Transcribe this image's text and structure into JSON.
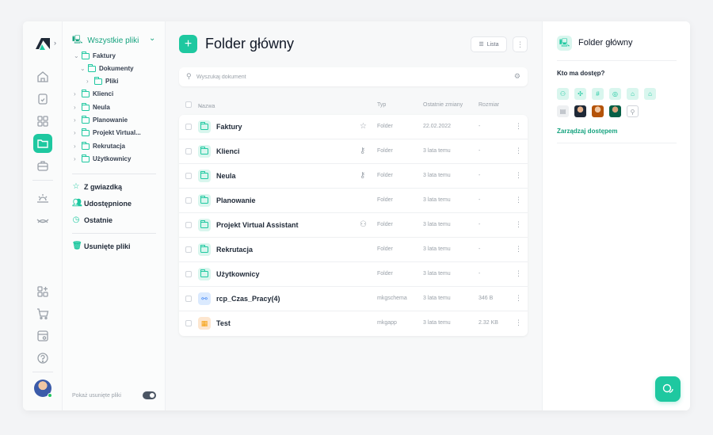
{
  "colors": {
    "accent": "#1ec8a0",
    "accent_dark": "#16a37f"
  },
  "tree": {
    "root_label": "Wszystkie pliki",
    "nodes": [
      {
        "label": "Faktury"
      },
      {
        "label": "Dokumenty"
      },
      {
        "label": "Pliki"
      },
      {
        "label": "Klienci"
      },
      {
        "label": "Neula"
      },
      {
        "label": "Planowanie"
      },
      {
        "label": "Projekt Virtual..."
      },
      {
        "label": "Rekrutacja"
      },
      {
        "label": "Użytkownicy"
      }
    ],
    "quick": [
      {
        "label": "Z gwiazdką",
        "icon": "star-icon"
      },
      {
        "label": "Udostępnione",
        "icon": "users-icon"
      },
      {
        "label": "Ostatnie",
        "icon": "clock-icon"
      },
      {
        "label": "Usunięte pliki",
        "icon": "trash-icon"
      }
    ],
    "show_deleted_label": "Pokaż usunięte pliki",
    "show_deleted_on": true
  },
  "main": {
    "title": "Folder główny",
    "view_label": "Lista",
    "search_placeholder": "Wyszukaj dokument",
    "columns": {
      "name": "Nazwa",
      "type": "Typ",
      "modified": "Ostatnie zmiany",
      "size": "Rozmiar"
    },
    "rows": [
      {
        "name": "Faktury",
        "flag": "star-icon",
        "type": "Folder",
        "modified": "22.02.2022",
        "size": "-",
        "icon": "folder-icon"
      },
      {
        "name": "Klienci",
        "flag": "key-icon",
        "type": "Folder",
        "modified": "3 lata temu",
        "size": "-",
        "icon": "folder-icon"
      },
      {
        "name": "Neula",
        "flag": "key-icon",
        "type": "Folder",
        "modified": "3 lata temu",
        "size": "-",
        "icon": "folder-icon"
      },
      {
        "name": "Planowanie",
        "flag": "",
        "type": "Folder",
        "modified": "3 lata temu",
        "size": "-",
        "icon": "folder-icon"
      },
      {
        "name": "Projekt Virtual Assistant",
        "flag": "users-icon",
        "type": "Folder",
        "modified": "3 lata temu",
        "size": "-",
        "icon": "folder-icon"
      },
      {
        "name": "Rekrutacja",
        "flag": "",
        "type": "Folder",
        "modified": "3 lata temu",
        "size": "-",
        "icon": "folder-icon"
      },
      {
        "name": "Użytkownicy",
        "flag": "",
        "type": "Folder",
        "modified": "3 lata temu",
        "size": "-",
        "icon": "folder-icon"
      },
      {
        "name": "rcp_Czas_Pracy(4)",
        "flag": "",
        "type": "mkgschema",
        "modified": "3 lata temu",
        "size": "346 B",
        "icon": "schema-icon"
      },
      {
        "name": "Test",
        "flag": "",
        "type": "mkgapp",
        "modified": "3 lata temu",
        "size": "2.32 KB",
        "icon": "app-icon"
      }
    ]
  },
  "panel": {
    "title": "Folder główny",
    "access_question": "Kto ma dostęp?",
    "manage_label": "Zarządzaj dostępem"
  }
}
